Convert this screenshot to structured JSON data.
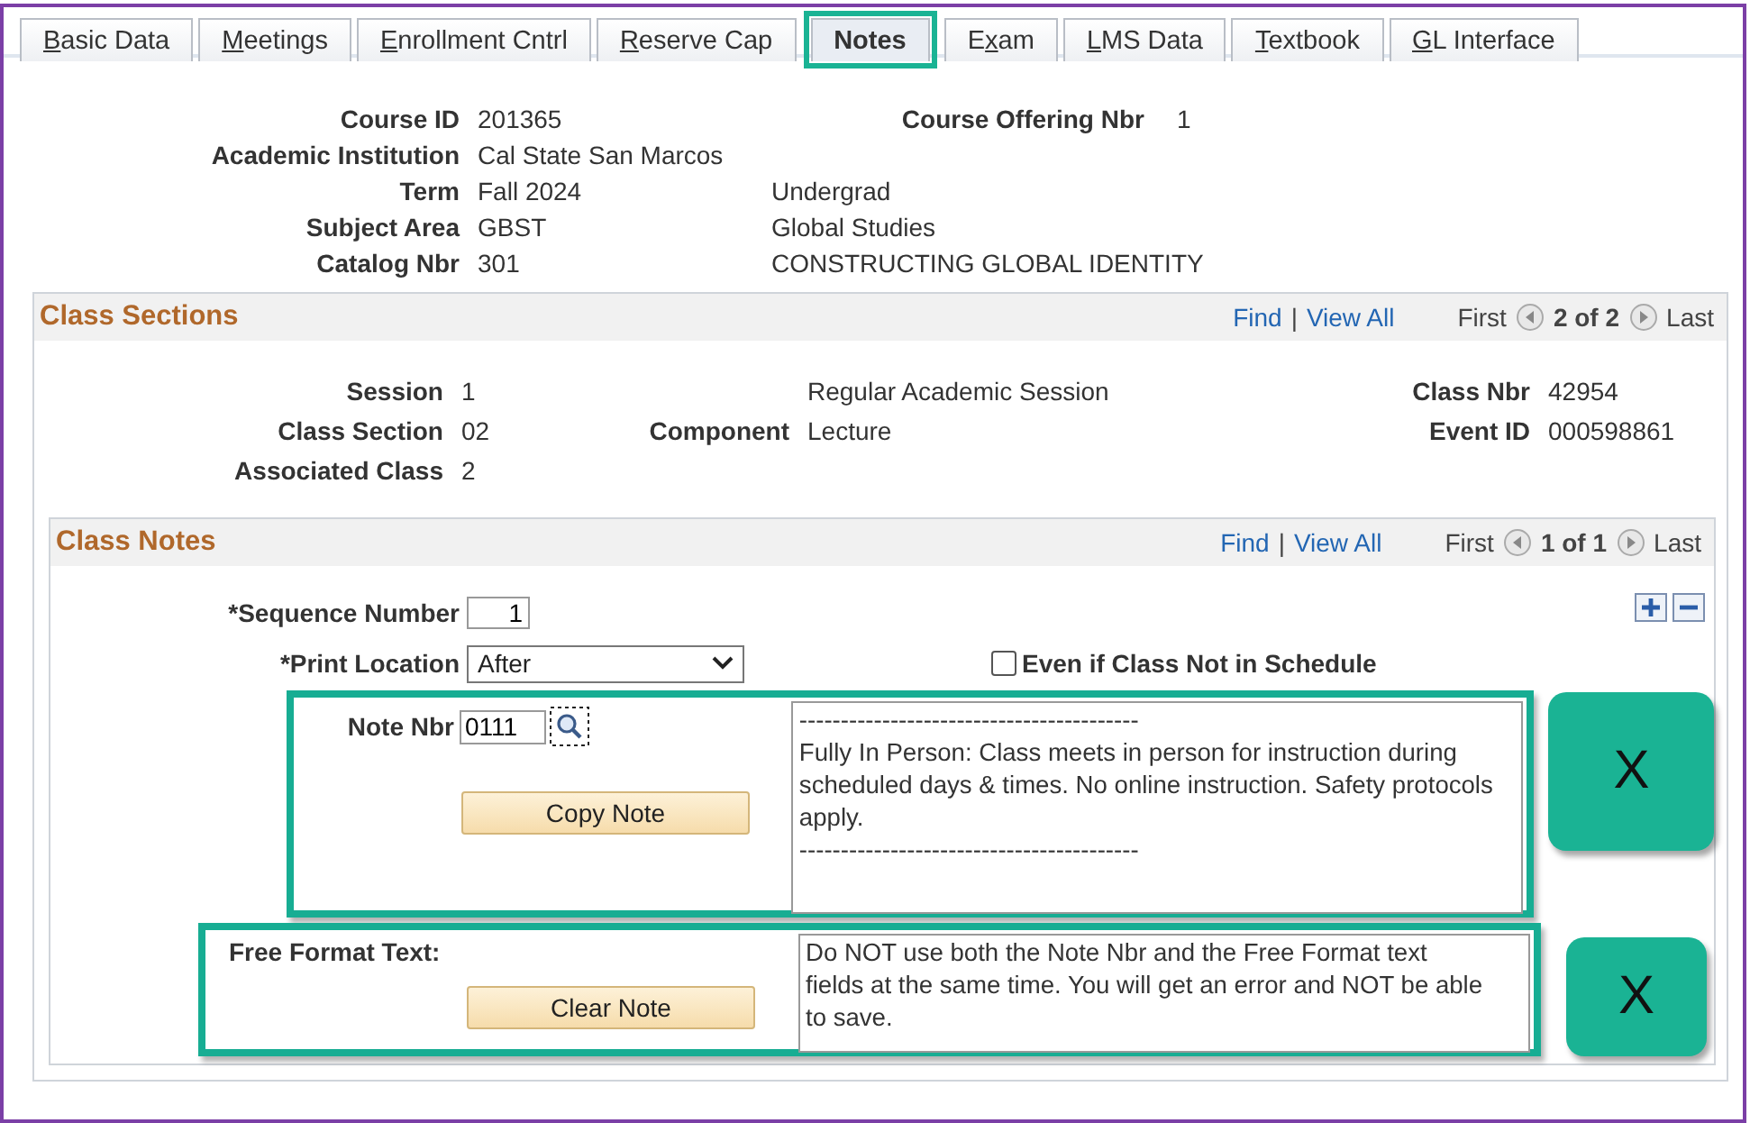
{
  "tabs": [
    {
      "access_key": "B",
      "label_end": "asic Data",
      "selected": false
    },
    {
      "access_key": "M",
      "label_end": "eetings",
      "selected": false
    },
    {
      "access_key": "E",
      "label_end": "nrollment Cntrl",
      "selected": false
    },
    {
      "access_key": "R",
      "label_end": "eserve Cap",
      "selected": false
    },
    {
      "label_start": "Notes",
      "selected": true
    },
    {
      "label_start": "E",
      "access_key": "x",
      "label_end": "am",
      "selected": false
    },
    {
      "access_key": "L",
      "label_end": "MS Data",
      "selected": false
    },
    {
      "access_key": "T",
      "label_end": "extbook",
      "selected": false
    },
    {
      "access_key": "G",
      "label_end": "L Interface",
      "selected": false
    }
  ],
  "course": {
    "course_id": {
      "label": "Course ID",
      "value": "201365"
    },
    "course_offering_nbr": {
      "label": "Course Offering Nbr",
      "value": "1"
    },
    "academic_institution": {
      "label": "Academic Institution",
      "value": "Cal State San Marcos"
    },
    "term": {
      "label": "Term",
      "value": "Fall 2024",
      "description": "Undergrad"
    },
    "subject_area": {
      "label": "Subject Area",
      "value": "GBST",
      "description": "Global Studies"
    },
    "catalog_nbr": {
      "label": "Catalog Nbr",
      "value": "301",
      "description": "CONSTRUCTING GLOBAL IDENTITY"
    }
  },
  "class_sections": {
    "title": "Class Sections",
    "find": "Find",
    "separator": "|",
    "view_all": "View All",
    "first": "First",
    "position": "2 of 2",
    "last": "Last",
    "session": {
      "label": "Session",
      "value": "1",
      "description": "Regular Academic Session"
    },
    "class_nbr": {
      "label": "Class Nbr",
      "value": "42954"
    },
    "class_section": {
      "label": "Class Section",
      "value": "02"
    },
    "component": {
      "label": "Component",
      "value": "Lecture"
    },
    "event_id": {
      "label": "Event ID",
      "value": "000598861"
    },
    "associated_class": {
      "label": "Associated Class",
      "value": "2"
    },
    "class_notes": {
      "title": "Class Notes",
      "find": "Find",
      "separator": "|",
      "view_all": "View All",
      "first": "First",
      "position": "1 of 1",
      "last": "Last",
      "sequence_number": {
        "label": "*Sequence Number",
        "value": "1"
      },
      "print_location": {
        "label": "*Print Location",
        "value": "After"
      },
      "even_if_not_in_schedule": {
        "label": "Even if Class Not in Schedule",
        "checked": false
      },
      "note_nbr": {
        "label": "Note Nbr",
        "value": "0111"
      },
      "copy_note": "Copy Note",
      "note_text": [
        "-----------------------------------------",
        "Fully In Person: Class meets in person for instruction during scheduled days & times. No online instruction. Safety protocols apply.",
        "-----------------------------------------"
      ],
      "free_format_label": "Free Format Text:",
      "clear_note": "Clear Note",
      "free_format_text": "Do NOT use both the Note Nbr and the Free Format text fields at the same time. You will get an error and NOT be able to save."
    }
  },
  "annotations": [
    "X",
    "X"
  ]
}
